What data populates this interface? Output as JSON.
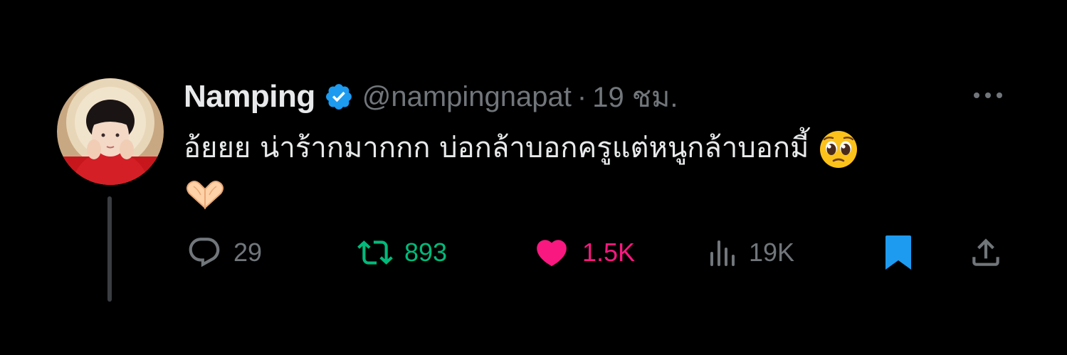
{
  "author": {
    "display_name": "Namping",
    "verified_icon": "verified-badge-icon",
    "handle": "@nampingnapat",
    "separator": "·",
    "time": "19 ชม."
  },
  "tweet": {
    "text": "อ้ยยย น่าร้ากมากกก บ่อกล้าบอกครูแต่หนูกล้าบอกมี้",
    "emojis": [
      "pleading-face-icon",
      "heart-hands-icon"
    ]
  },
  "actions": {
    "reply_count": "29",
    "retweet_count": "893",
    "like_count": "1.5K",
    "views_count": "19K"
  },
  "colors": {
    "background": "#000000",
    "text": "#e7e9ea",
    "secondary": "#71767b",
    "verified": "#1d9bf0",
    "retweet": "#00ba7c",
    "like": "#f91880",
    "bookmark": "#1d9bf0"
  }
}
